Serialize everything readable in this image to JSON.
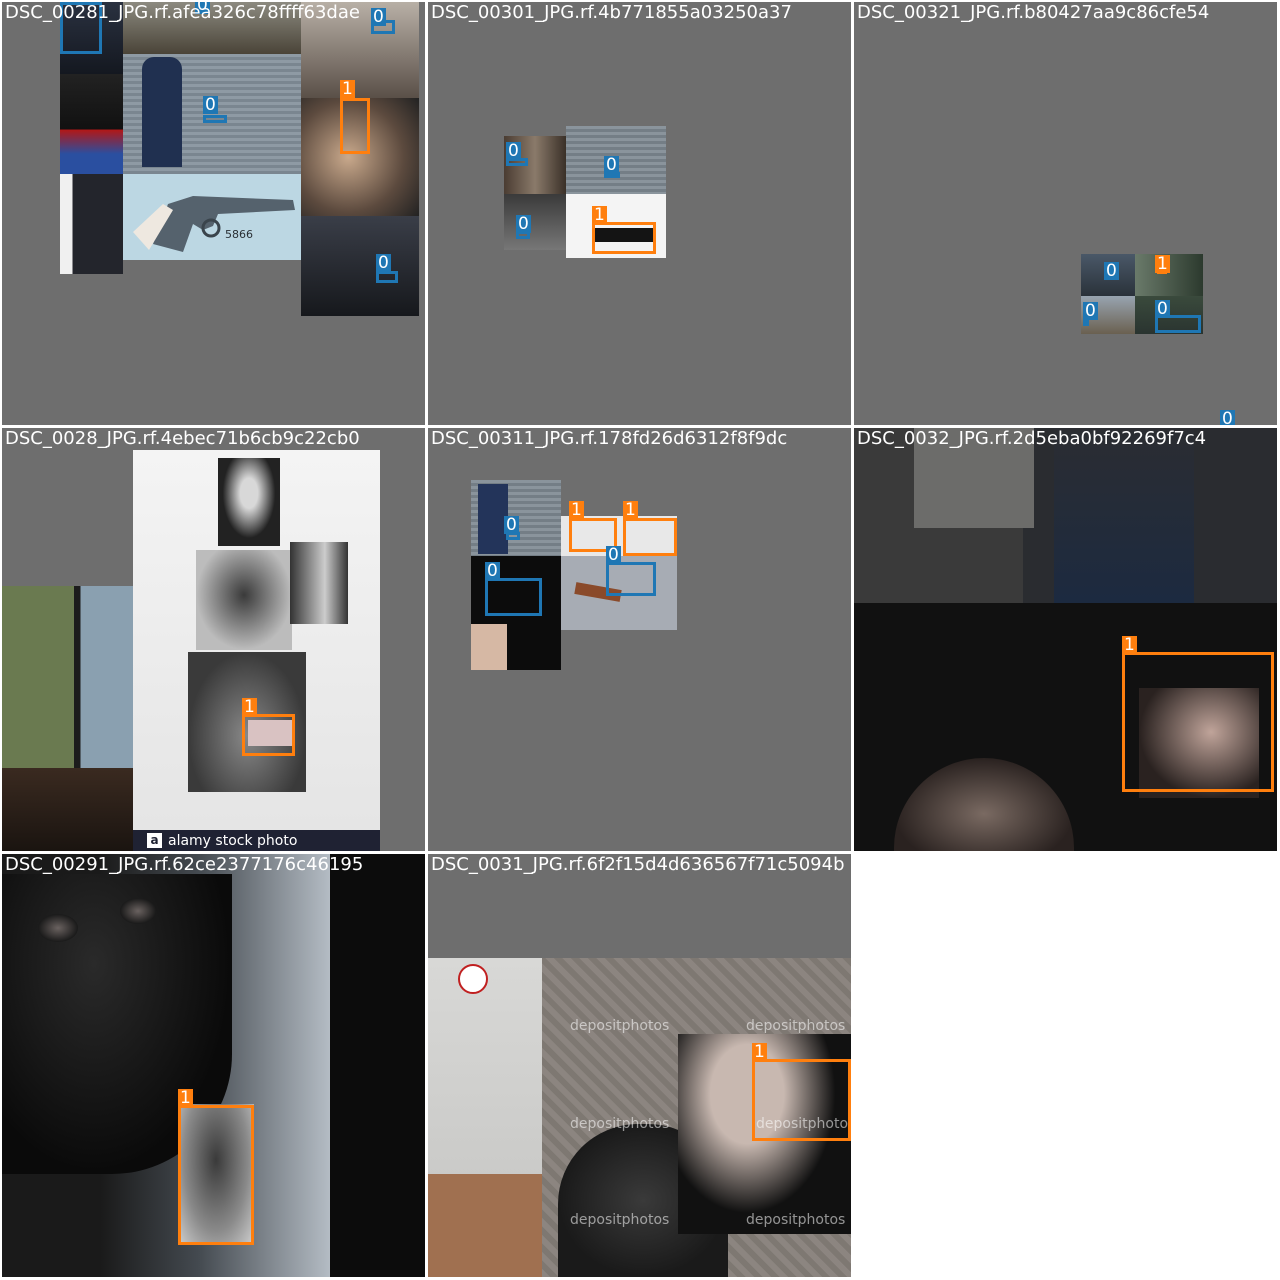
{
  "grid": {
    "tiles": [
      {
        "title": "DSC_00281_JPG.rf.afea326c78ffff63dae"
      },
      {
        "title": "DSC_00301_JPG.rf.4b771855a03250a37"
      },
      {
        "title": "DSC_00321_JPG.rf.b80427aa9c86cfe54"
      },
      {
        "title": "DSC_0028_JPG.rf.4ebec71b6cb9c22cb0"
      },
      {
        "title": "DSC_00311_JPG.rf.178fd26d6312f8f9dc"
      },
      {
        "title": "DSC_0032_JPG.rf.2d5eba0bf92269f7c4"
      },
      {
        "title": "DSC_00291_JPG.rf.62ce2377176c46195"
      },
      {
        "title": "DSC_0031_JPG.rf.6f2f15d4d636567f71c5094b"
      }
    ]
  },
  "labels": {
    "class0": "0",
    "class1": "1"
  },
  "watermarks": {
    "alamy": "alamy stock photo",
    "alamy_logo": "a",
    "depositphotos": "depositphotos",
    "revolver_serial": "5866"
  },
  "colors": {
    "class0": "#1f77b4",
    "class1": "#ff7f0e",
    "tile_background": "#6e6e6e"
  }
}
